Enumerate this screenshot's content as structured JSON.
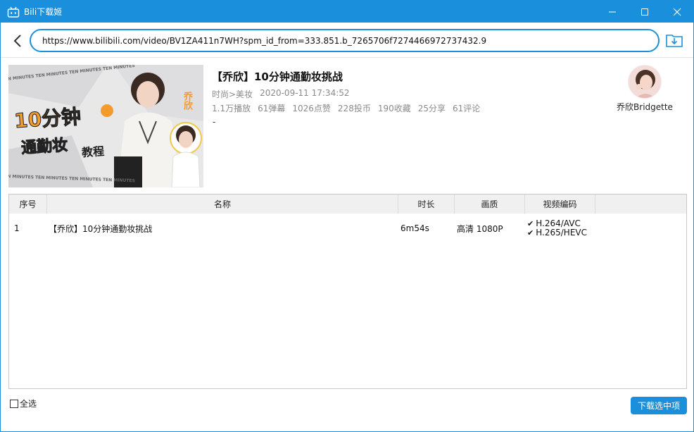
{
  "window": {
    "title": "Bili下载姬",
    "accent": "#1a90dc"
  },
  "url_bar": {
    "value": "https://www.bilibili.com/video/BV1ZA411n7WH?spm_id_from=333.851.b_7265706f7274466972737432.9"
  },
  "video": {
    "title": "【乔欣】10分钟通勤妆挑战",
    "category": "时尚>美妆",
    "date": "2020-09-11 17:34:52",
    "stats": [
      "1.1万播放",
      "61弹幕",
      "1026点赞",
      "228投币",
      "190收藏",
      "25分享",
      "61评论"
    ],
    "description": "-",
    "uploader": "乔欣Bridgette",
    "thumbnail": {
      "big_text_1": "10分钟",
      "big_text_2": "通勤妆",
      "big_text_3": "教程",
      "side_text": "乔欣",
      "banner": "TEN MINUTES TEN MINUTES TEN MINUTES TEN MINUTES"
    }
  },
  "table": {
    "headers": [
      "序号",
      "名称",
      "时长",
      "画质",
      "视频编码"
    ],
    "rows": [
      {
        "index": "1",
        "name": "【乔欣】10分钟通勤妆挑战",
        "duration": "6m54s",
        "quality": "高清 1080P",
        "codecs": [
          "H.264/AVC",
          "H.265/HEVC"
        ]
      }
    ]
  },
  "footer": {
    "select_all": "全选",
    "download_selected": "下载选中项"
  },
  "icons": [
    "app-tv-icon",
    "minimize-icon",
    "maximize-icon",
    "close-icon",
    "back-arrow-icon",
    "download-folder-icon",
    "check-icon"
  ]
}
